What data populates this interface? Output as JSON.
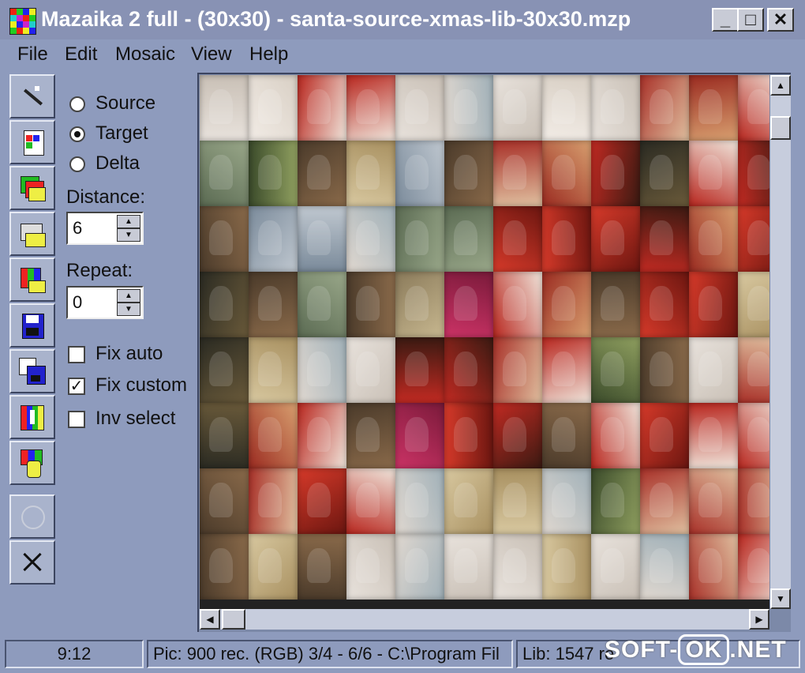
{
  "window": {
    "title": "Mazaika 2 full - (30x30) - santa-source-xmas-lib-30x30.mzp",
    "controls": {
      "minimize": "_",
      "maximize": "□",
      "close": "✕"
    }
  },
  "menu": [
    "File",
    "Edit",
    "Mosaic",
    "View",
    "Help"
  ],
  "toolbar": [
    {
      "name": "magic-wand-icon"
    },
    {
      "name": "new-document-icon"
    },
    {
      "name": "image-library-icon"
    },
    {
      "name": "open-folder-icon"
    },
    {
      "name": "color-grid-icon"
    },
    {
      "name": "save-disk-icon"
    },
    {
      "name": "save-as-disk-icon"
    },
    {
      "name": "export-mosaic-icon"
    },
    {
      "name": "hand-select-icon"
    },
    {
      "name": "circle-icon"
    },
    {
      "name": "cross-icon"
    }
  ],
  "options": {
    "view_mode": {
      "items": [
        "Source",
        "Target",
        "Delta"
      ],
      "selected": "Target"
    },
    "distance": {
      "label": "Distance:",
      "value": "6"
    },
    "repeat": {
      "label": "Repeat:",
      "value": "0"
    },
    "checks": [
      {
        "label": "Fix auto",
        "checked": false
      },
      {
        "label": "Fix custom",
        "checked": true
      },
      {
        "label": "Inv select",
        "checked": false
      }
    ]
  },
  "status": {
    "time": "9:12",
    "pic": "Pic: 900 rec. (RGB) 3/4 - 6/6 - C:\\Program Fil",
    "lib": "Lib: 1547 re"
  },
  "watermark": {
    "left": "SOFT-",
    "ok": "OK",
    "right": ".NET"
  },
  "colors": {
    "window_bg": "#8e9bbd",
    "title_bar": "#8892b4",
    "accent_red": "#c8281e"
  }
}
